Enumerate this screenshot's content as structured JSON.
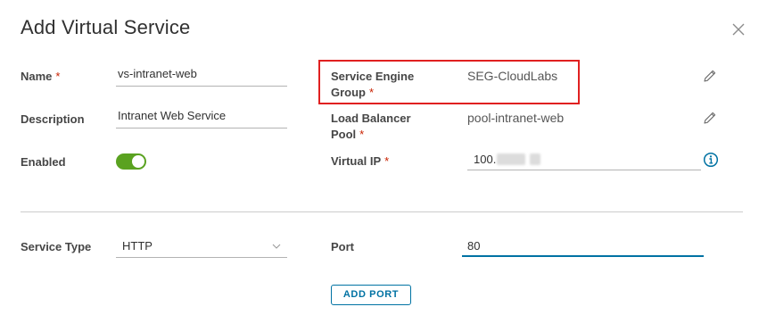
{
  "dialog": {
    "title": "Add Virtual Service",
    "close_icon": "close-icon"
  },
  "form": {
    "name": {
      "label": "Name",
      "required": "*",
      "value": "vs-intranet-web"
    },
    "description": {
      "label": "Description",
      "value": "Intranet Web Service"
    },
    "enabled": {
      "label": "Enabled",
      "state": "on"
    },
    "service_engine_group": {
      "label_line1": "Service Engine",
      "label_line2": "Group",
      "required": "*",
      "value": "SEG-CloudLabs",
      "edit_icon": "pencil-icon"
    },
    "load_balancer_pool": {
      "label_line1": "Load Balancer",
      "label_line2": "Pool",
      "required": "*",
      "value": "pool-intranet-web",
      "edit_icon": "pencil-icon"
    },
    "virtual_ip": {
      "label": "Virtual IP",
      "required": "*",
      "value_visible": "100.",
      "info_icon": "info-circle-icon"
    },
    "service_type": {
      "label": "Service Type",
      "selected": "HTTP"
    },
    "port": {
      "label": "Port",
      "value": "80"
    },
    "add_port_label": "ADD PORT"
  },
  "colors": {
    "accent": "#0072a3",
    "toggle_on": "#5aa220",
    "required": "#c92100",
    "highlight": "#e02020"
  }
}
